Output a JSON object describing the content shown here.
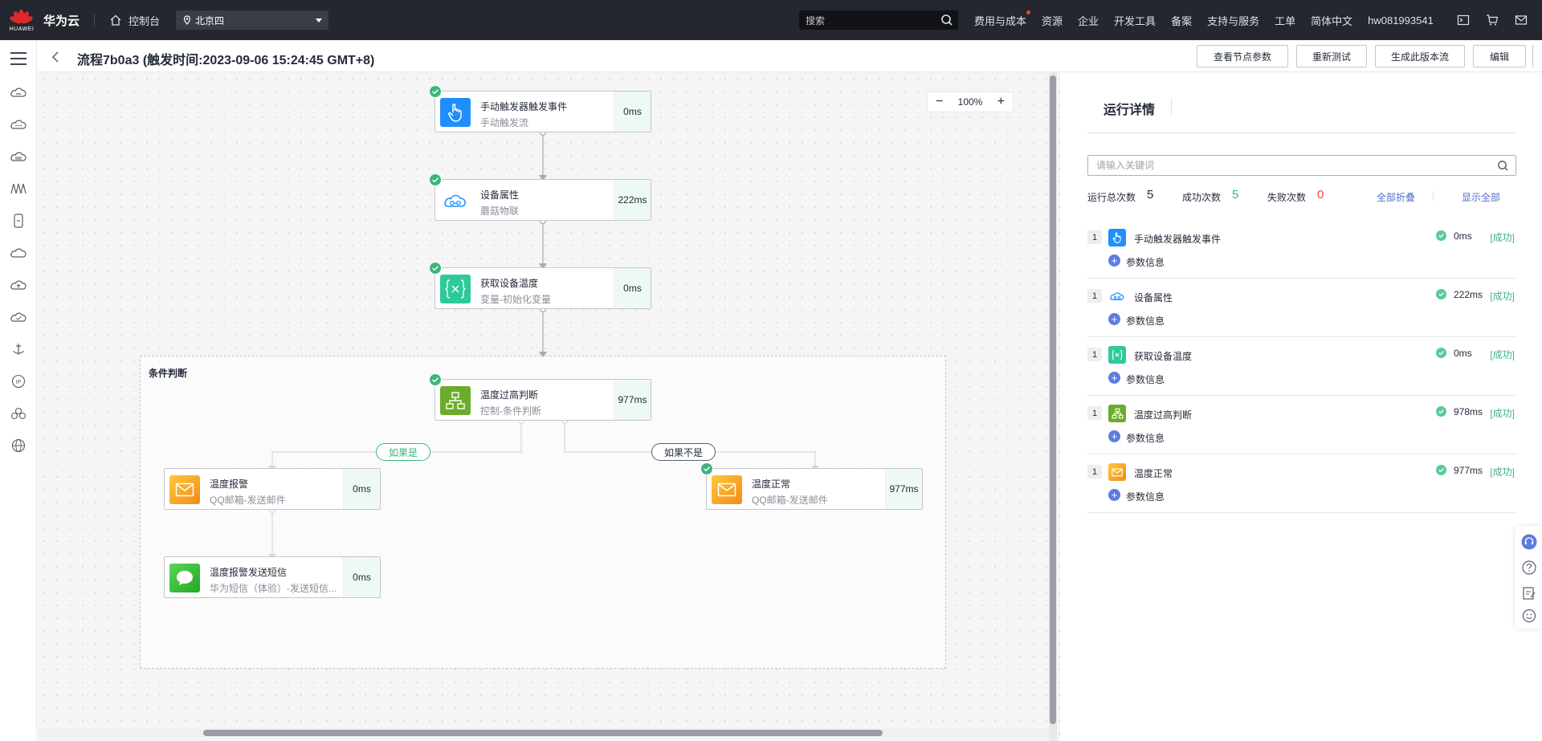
{
  "topbar": {
    "logo_text": "HUAWEI",
    "brand": "华为云",
    "console": "控制台",
    "region": "北京四",
    "search_placeholder": "搜索",
    "nav": [
      "费用与成本",
      "资源",
      "企业",
      "开发工具",
      "备案",
      "支持与服务",
      "工单",
      "简体中文",
      "hw081993541"
    ]
  },
  "header": {
    "title": "流程7b0a3 (触发时间:2023-09-06 15:24:45 GMT+8)",
    "buttons": [
      "查看节点参数",
      "重新测试",
      "生成此版本流",
      "编辑"
    ]
  },
  "canvas": {
    "zoom": "100%",
    "group_label": "条件判断",
    "nodes": [
      {
        "title": "手动触发器触发事件",
        "subtitle": "手动触发流",
        "time": "0ms",
        "icon": "hand-pointer-icon",
        "color": "#1e8ffe"
      },
      {
        "title": "设备属性",
        "subtitle": "蘑菇物联",
        "time": "222ms",
        "icon": "cloud-icon",
        "color": "#ffffff"
      },
      {
        "title": "获取设备温度",
        "subtitle": "变量-初始化变量",
        "time": "0ms",
        "icon": "variable-icon",
        "color": "#2ec99b"
      },
      {
        "title": "温度过高判断",
        "subtitle": "控制-条件判断",
        "time": "977ms",
        "icon": "branch-icon",
        "color": "#6bac2a"
      },
      {
        "title": "温度报警",
        "subtitle": "QQ邮箱-发送邮件",
        "time": "0ms",
        "icon": "mail-icon",
        "color": "#f5a623"
      },
      {
        "title": "温度正常",
        "subtitle": "QQ邮箱-发送邮件",
        "time": "977ms",
        "icon": "mail-icon",
        "color": "#f5a623"
      },
      {
        "title": "温度报警发送短信",
        "subtitle": "华为短信（体验）-发送短信...",
        "time": "0ms",
        "icon": "sms-icon",
        "color": "#3fc23f"
      }
    ],
    "cond_yes": "如果是",
    "cond_no": "如果不是"
  },
  "panel": {
    "title": "运行详情",
    "search_placeholder": "请输入关键词",
    "total_label": "运行总次数",
    "total": "5",
    "success_label": "成功次数",
    "success": "5",
    "fail_label": "失败次数",
    "fail": "0",
    "collapse_all": "全部折叠",
    "show_all": "显示全部",
    "param_label": "参数信息",
    "items": [
      {
        "index": "1",
        "name": "手动触发器触发事件",
        "time": "0ms",
        "status": "[成功]"
      },
      {
        "index": "1",
        "name": "设备属性",
        "time": "222ms",
        "status": "[成功]"
      },
      {
        "index": "1",
        "name": "获取设备温度",
        "time": "0ms",
        "status": "[成功]"
      },
      {
        "index": "1",
        "name": "温度过高判断",
        "time": "978ms",
        "status": "[成功]"
      },
      {
        "index": "1",
        "name": "温度正常",
        "time": "977ms",
        "status": "[成功]"
      }
    ]
  },
  "colors": {
    "topbar": "#24272f",
    "success": "#3fb47e",
    "fail": "#e8493d",
    "link": "#526ecc"
  }
}
